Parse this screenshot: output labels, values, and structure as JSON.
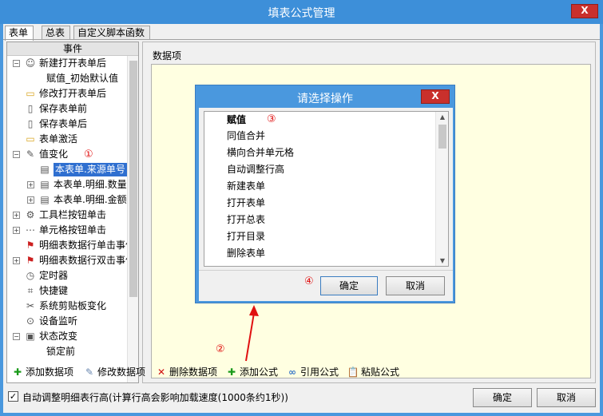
{
  "window": {
    "title": "填表公式管理",
    "close_label": "X"
  },
  "tabs": [
    {
      "label": "表单"
    },
    {
      "label": "总表"
    },
    {
      "label": "自定义脚本函数"
    }
  ],
  "tree": {
    "header": "事件",
    "items": [
      {
        "label": "新建打开表单后",
        "icon": "user-icon",
        "expander": "minus"
      },
      {
        "label": "赋值_初始默认值",
        "icon": "",
        "expander": ""
      },
      {
        "label": "修改打开表单后",
        "icon": "folder-icon",
        "expander": ""
      },
      {
        "label": "保存表单前",
        "icon": "doc-icon",
        "expander": ""
      },
      {
        "label": "保存表单后",
        "icon": "doc-icon",
        "expander": ""
      },
      {
        "label": "表单激活",
        "icon": "folder-icon",
        "expander": ""
      },
      {
        "label": "值变化",
        "icon": "edit-icon",
        "expander": "minus",
        "marker": "①"
      },
      {
        "label": "本表单.来源单号",
        "icon": "table-icon",
        "expander": "",
        "selected": true
      },
      {
        "label": "本表单.明细.数量",
        "icon": "table-icon",
        "expander": "plus"
      },
      {
        "label": "本表单.明细.金额",
        "icon": "table-icon",
        "expander": "plus"
      },
      {
        "label": "工具栏按钮单击",
        "icon": "tool-icon",
        "expander": "plus"
      },
      {
        "label": "单元格按钮单击",
        "icon": "dots-icon",
        "expander": "plus"
      },
      {
        "label": "明细表数据行单击事件",
        "icon": "flag-icon",
        "expander": "plus"
      },
      {
        "label": "明细表数据行双击事件",
        "icon": "flag-icon",
        "expander": "plus"
      },
      {
        "label": "定时器",
        "icon": "timer-icon",
        "expander": ""
      },
      {
        "label": "快捷键",
        "icon": "key-icon",
        "expander": ""
      },
      {
        "label": "系统剪贴板变化",
        "icon": "scissors-icon",
        "expander": ""
      },
      {
        "label": "设备监听",
        "icon": "device-icon",
        "expander": ""
      },
      {
        "label": "状态改变",
        "icon": "status-icon",
        "expander": "minus"
      },
      {
        "label": "锁定前",
        "icon": "",
        "expander": ""
      }
    ]
  },
  "data_panel": {
    "label": "数据项"
  },
  "toolbar": {
    "add_data": "添加数据项",
    "edit_data": "修改数据项",
    "delete_data": "删除数据项",
    "add_formula": "添加公式",
    "ref_formula": "引用公式",
    "paste_formula": "粘贴公式"
  },
  "footer": {
    "checkbox_label": "自动调整明细表行高(计算行高会影响加载速度(1000条约1秒))",
    "checkbox_checked": true,
    "ok": "确定",
    "cancel": "取消"
  },
  "modal": {
    "title": "请选择操作",
    "close_label": "X",
    "items": [
      "赋值",
      "同值合并",
      "横向合并单元格",
      "自动调整行高",
      "新建表单",
      "打开表单",
      "打开总表",
      "打开目录",
      "删除表单",
      ""
    ],
    "ok": "确定",
    "cancel": "取消"
  },
  "annotations": {
    "m1": "①",
    "m2": "②",
    "m3": "③",
    "m4": "④"
  }
}
